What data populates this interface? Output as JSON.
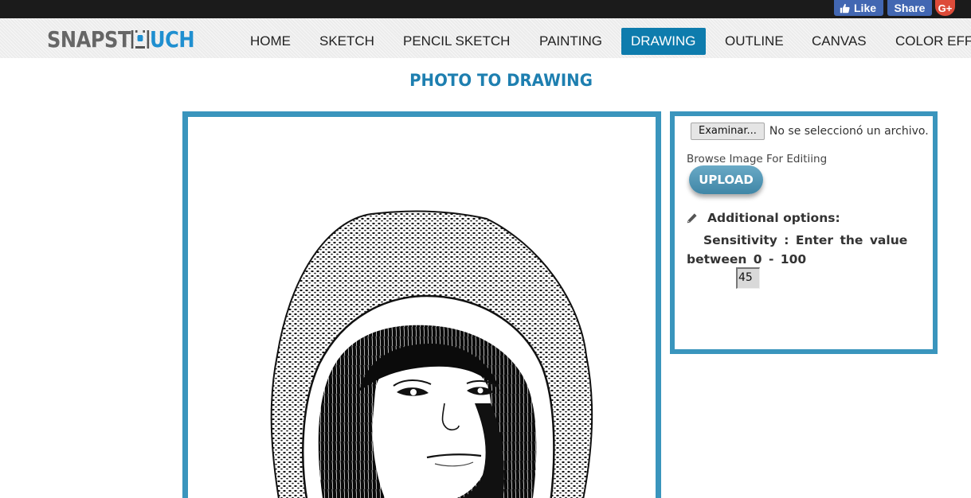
{
  "social": {
    "like_label": "Like",
    "share_label": "Share",
    "gplus_label": "G+",
    "fb_color": "#4267b2",
    "gplus_color": "#dd4b39"
  },
  "logo": {
    "part1": "SNAPST",
    "part2": "UCH",
    "accent_color": "#1f8fd0"
  },
  "nav": {
    "items": [
      "HOME",
      "SKETCH",
      "PENCIL SKETCH",
      "PAINTING",
      "DRAWING",
      "OUTLINE",
      "CANVAS",
      "COLOR EFF"
    ],
    "active": "DRAWING",
    "active_color": "#0e7cad"
  },
  "page": {
    "title": "PHOTO TO DRAWING",
    "title_color": "#1e7fb0",
    "panel_border_color": "#3a95bd"
  },
  "image_panel": {
    "content": "sketch-portrait-image"
  },
  "options": {
    "file_button_label": "Examinar...",
    "file_status": "No se seleccionó un archivo.",
    "browse_label": "Browse Image For Editiing",
    "upload_label": "UPLOAD",
    "additional_title": "Additional options:",
    "sensitivity_text": "Sensitivity : Enter the value between 0 - 100",
    "sensitivity_value": "45",
    "icons": [
      "pencil-icon"
    ]
  }
}
